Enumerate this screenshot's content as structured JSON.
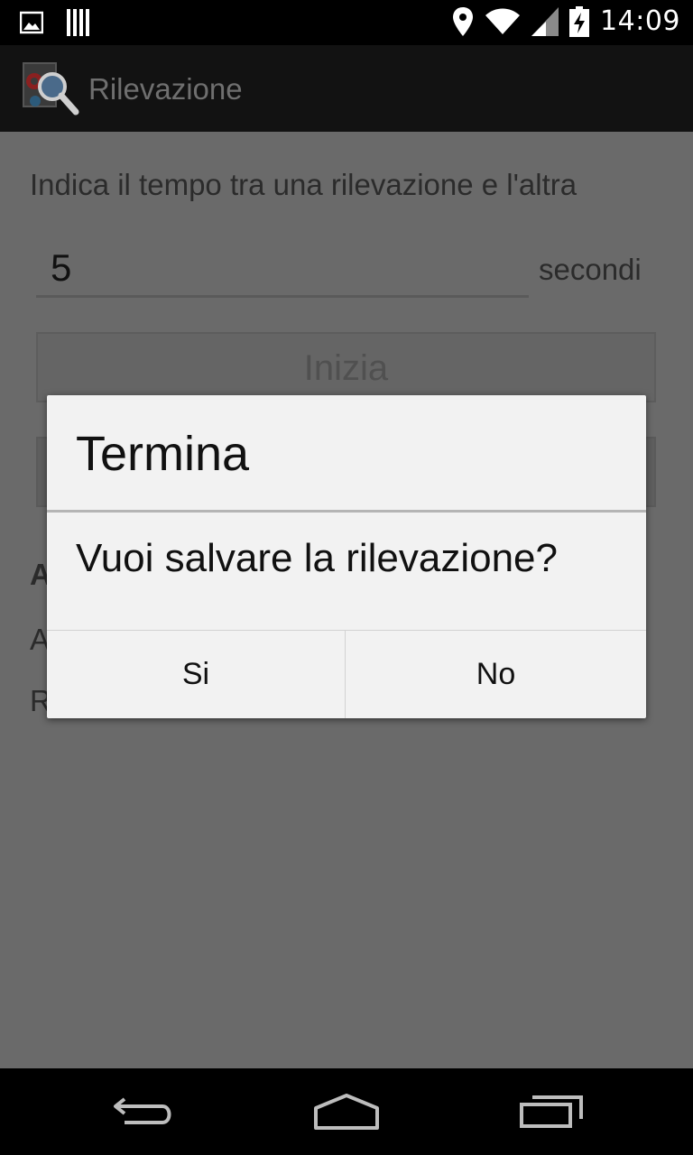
{
  "status_bar": {
    "time": "14:09",
    "icons": [
      "image-notification-icon",
      "barcode-notification-icon",
      "location-icon",
      "wifi-icon",
      "signal-icon",
      "battery-charging-icon"
    ]
  },
  "action_bar": {
    "title": "Rilevazione",
    "icon": "app-magnifier-gear-icon"
  },
  "content": {
    "instruction": "Indica il tempo tra una rilevazione e l'altra",
    "interval_value": "5",
    "unit": "secondi",
    "start_button": "Inizia",
    "partial_lines": [
      "A",
      "A",
      "R"
    ]
  },
  "dialog": {
    "title": "Termina",
    "message": "Vuoi salvare la rilevazione?",
    "positive": "Si",
    "negative": "No"
  },
  "nav_bar": {
    "icons": [
      "back-icon",
      "home-icon",
      "recent-apps-icon"
    ]
  },
  "colors": {
    "scrim": "#6a6a6a",
    "dialog_bg": "#f2f2f2",
    "action_bar_bg": "#121212"
  }
}
